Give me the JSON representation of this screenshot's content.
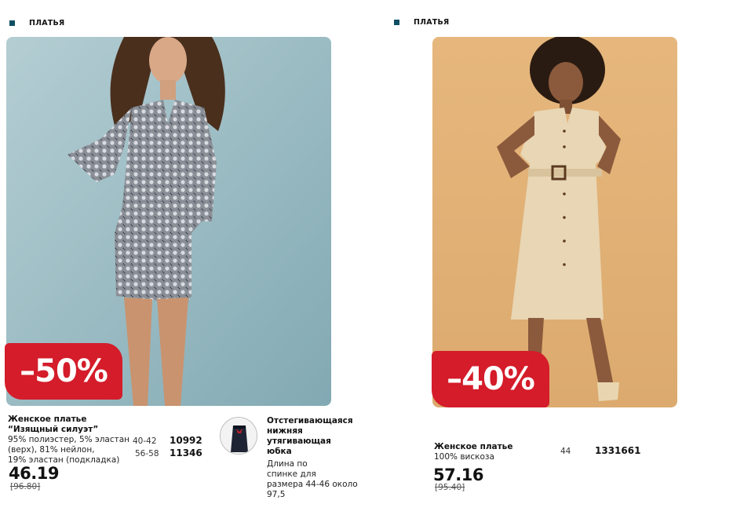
{
  "left": {
    "section_label": "ПЛАТЬЯ",
    "discount": "–50%",
    "product": {
      "title_line1": "Женское платье",
      "title_line2": "“Изящный силуэт”",
      "composition_line1": "95% полиэстер, 5% эластан",
      "composition_line2": "(верх), 81% нейлон,",
      "composition_line3": "19% эластан (подкладка)",
      "sizes": [
        {
          "size": "40-42",
          "code": "10992"
        },
        {
          "size": "56-58",
          "code": "11346"
        }
      ],
      "price": "46.19",
      "old_price": "[96.80]"
    },
    "accessory": {
      "title_line1": "Отстегивающаяся",
      "title_line2": "нижняя",
      "title_line3": "утягивающая",
      "title_line4": "юбка",
      "desc_line1": "Длина по",
      "desc_line2": "спинке для",
      "desc_line3": "размера 44-46 около",
      "desc_line4": "97,5"
    },
    "photo_bg": "#9fc0c8"
  },
  "right": {
    "section_label": "ПЛАТЬЯ",
    "discount": "–40%",
    "product": {
      "title": "Женское платье",
      "composition": "100% вискоза",
      "size": "44",
      "code": "1331661",
      "price": "57.16",
      "old_price": "[95.40]"
    },
    "photo_bg": "#e3b378"
  },
  "colors": {
    "badge": "#d41c2a",
    "bullet": "#0f4f63"
  }
}
